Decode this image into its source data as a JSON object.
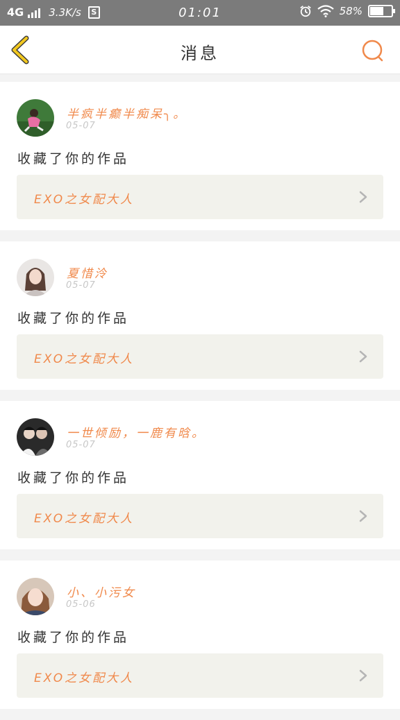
{
  "status_bar": {
    "network": "4G",
    "speed": "3.3K/s",
    "s_icon": "S",
    "time": "01:01",
    "battery_percent": "58%",
    "battery_level": 0.58,
    "icons": [
      "signal-icon",
      "alarm-icon",
      "wifi-icon",
      "battery-icon"
    ]
  },
  "nav": {
    "title": "消息",
    "back_icon": "chevron-left-icon",
    "search_icon": "search-icon",
    "accent_color": "#f0894b",
    "back_color": "#f2c81f"
  },
  "messages": [
    {
      "username": "半疯半癫半痴呆╮。",
      "date": "05-07",
      "action": "收藏了你的作品",
      "work_title": "EXO之女配大人"
    },
    {
      "username": "夏惜泠",
      "date": "05-07",
      "action": "收藏了你的作品",
      "work_title": "EXO之女配大人"
    },
    {
      "username": "一世倾励，一鹿有晗。",
      "date": "05-07",
      "action": "收藏了你的作品",
      "work_title": "EXO之女配大人"
    },
    {
      "username": "小、小污女",
      "date": "05-06",
      "action": "收藏了你的作品",
      "work_title": "EXO之女配大人"
    }
  ]
}
